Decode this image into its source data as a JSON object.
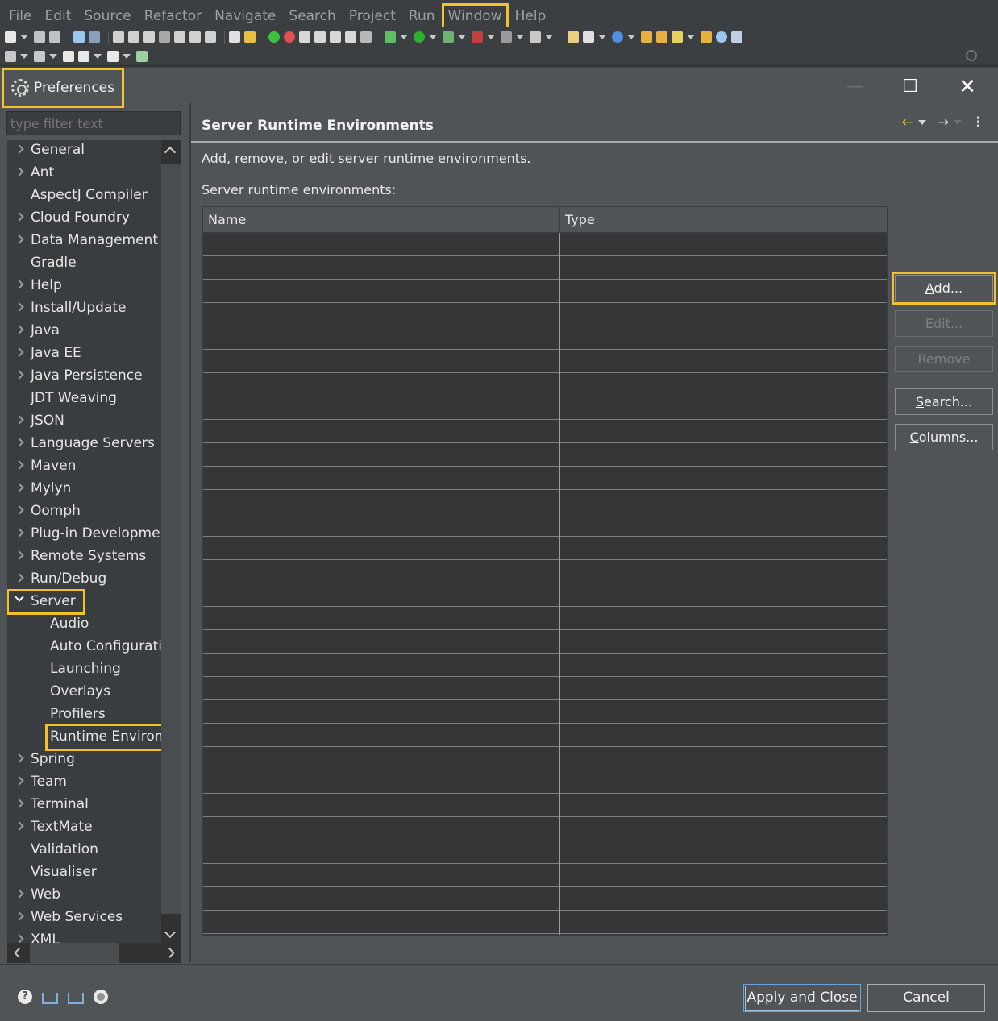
{
  "menu": [
    "File",
    "Edit",
    "Source",
    "Refactor",
    "Navigate",
    "Search",
    "Project",
    "Run",
    "Window",
    "Help"
  ],
  "dialog": {
    "title": "Preferences",
    "filter_placeholder": "type filter text",
    "minimize": "—",
    "maximize": "☐",
    "close": "✕"
  },
  "tree": [
    {
      "label": "General",
      "expandable": true,
      "indent": 0
    },
    {
      "label": "Ant",
      "expandable": true,
      "indent": 0
    },
    {
      "label": "AspectJ Compiler",
      "expandable": false,
      "indent": 0
    },
    {
      "label": "Cloud Foundry",
      "expandable": true,
      "indent": 0
    },
    {
      "label": "Data Management",
      "expandable": true,
      "indent": 0
    },
    {
      "label": "Gradle",
      "expandable": false,
      "indent": 0
    },
    {
      "label": "Help",
      "expandable": true,
      "indent": 0
    },
    {
      "label": "Install/Update",
      "expandable": true,
      "indent": 0
    },
    {
      "label": "Java",
      "expandable": true,
      "indent": 0
    },
    {
      "label": "Java EE",
      "expandable": true,
      "indent": 0
    },
    {
      "label": "Java Persistence",
      "expandable": true,
      "indent": 0
    },
    {
      "label": "JDT Weaving",
      "expandable": false,
      "indent": 0
    },
    {
      "label": "JSON",
      "expandable": true,
      "indent": 0
    },
    {
      "label": "Language Servers",
      "expandable": true,
      "indent": 0
    },
    {
      "label": "Maven",
      "expandable": true,
      "indent": 0
    },
    {
      "label": "Mylyn",
      "expandable": true,
      "indent": 0
    },
    {
      "label": "Oomph",
      "expandable": true,
      "indent": 0
    },
    {
      "label": "Plug-in Developmer",
      "expandable": true,
      "indent": 0
    },
    {
      "label": "Remote Systems",
      "expandable": true,
      "indent": 0
    },
    {
      "label": "Run/Debug",
      "expandable": true,
      "indent": 0
    },
    {
      "label": "Server",
      "expandable": true,
      "expanded": true,
      "indent": 0
    },
    {
      "label": "Audio",
      "expandable": false,
      "indent": 1
    },
    {
      "label": "Auto Configuratic",
      "expandable": false,
      "indent": 1
    },
    {
      "label": "Launching",
      "expandable": false,
      "indent": 1
    },
    {
      "label": "Overlays",
      "expandable": false,
      "indent": 1
    },
    {
      "label": "Profilers",
      "expandable": false,
      "indent": 1
    },
    {
      "label": "Runtime Environr",
      "expandable": false,
      "indent": 1,
      "selected": true
    },
    {
      "label": "Spring",
      "expandable": true,
      "indent": 0
    },
    {
      "label": "Team",
      "expandable": true,
      "indent": 0
    },
    {
      "label": "Terminal",
      "expandable": true,
      "indent": 0
    },
    {
      "label": "TextMate",
      "expandable": true,
      "indent": 0
    },
    {
      "label": "Validation",
      "expandable": false,
      "indent": 0
    },
    {
      "label": "Visualiser",
      "expandable": false,
      "indent": 0
    },
    {
      "label": "Web",
      "expandable": true,
      "indent": 0
    },
    {
      "label": "Web Services",
      "expandable": true,
      "indent": 0
    },
    {
      "label": "XML",
      "expandable": true,
      "indent": 0
    }
  ],
  "page": {
    "title": "Server Runtime Environments",
    "description": "Add, remove, or edit server runtime environments.",
    "list_label": "Server runtime environments:",
    "columns": [
      "Name",
      "Type"
    ],
    "buttons": {
      "add": {
        "mnemonic": "A",
        "rest": "dd..."
      },
      "edit": "Edit...",
      "remove": "Remove",
      "search": {
        "mnemonic": "S",
        "rest": "earch..."
      },
      "columns": {
        "mnemonic": "C",
        "rest": "olumns..."
      }
    }
  },
  "footer": {
    "apply_close": "Apply and Close",
    "cancel": "Cancel"
  },
  "colors": {
    "highlight": "#f2c12e",
    "dialog_bg": "#505456",
    "table_bg": "#353638"
  }
}
